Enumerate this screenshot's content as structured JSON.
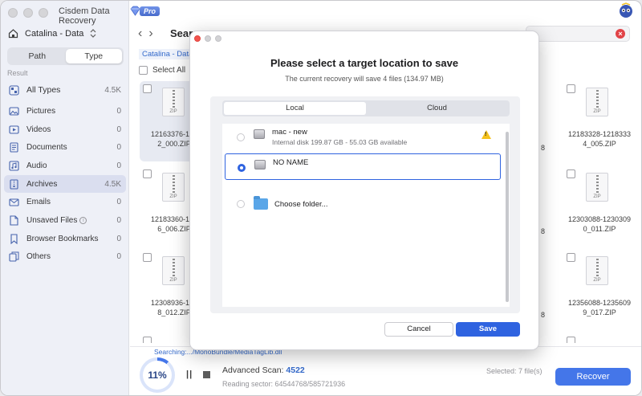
{
  "app": {
    "title": "Cisdem Data Recovery",
    "badge": "Pro"
  },
  "sidebar": {
    "drive_name": "Catalina - Data",
    "view_tabs": [
      "Path",
      "Type"
    ],
    "active_view": "Type",
    "result_label": "Result",
    "items": [
      {
        "label": "All Types",
        "count": "4.5K",
        "icon": "all-types-icon"
      },
      {
        "label": "Pictures",
        "count": "0",
        "icon": "picture-icon"
      },
      {
        "label": "Videos",
        "count": "0",
        "icon": "video-icon"
      },
      {
        "label": "Documents",
        "count": "0",
        "icon": "document-icon"
      },
      {
        "label": "Audio",
        "count": "0",
        "icon": "audio-icon"
      },
      {
        "label": "Archives",
        "count": "4.5K",
        "icon": "archive-icon"
      },
      {
        "label": "Emails",
        "count": "0",
        "icon": "email-icon"
      },
      {
        "label": "Unsaved Files",
        "count": "0",
        "icon": "unsaved-files-icon"
      },
      {
        "label": "Browser Bookmarks",
        "count": "0",
        "icon": "bookmark-icon"
      },
      {
        "label": "Others",
        "count": "0",
        "icon": "others-icon"
      }
    ],
    "active_item": "Archives"
  },
  "main": {
    "title_fragment": "Sear",
    "breadcrumb": "Catalina - Data",
    "select_all_label": "Select All",
    "files": {
      "col1": [
        "12163376-121\n2_000.ZIP",
        "12183360-121\n6_006.ZIP",
        "12308936-123\n8_012.ZIP"
      ],
      "col_right": [
        "12183328-1218333\n4_005.ZIP",
        "12303088-1230309\n0_011.ZIP",
        "12356088-1235609\n9_017.ZIP"
      ],
      "right_edge_fragments": [
        "8",
        "8",
        "8"
      ],
      "zip_label": "ZIP"
    },
    "status_searching": "Searching:.../MonoBundle/MediaTagLib.dll"
  },
  "bottom": {
    "progress_percent": "11%",
    "progress_value": 0.11,
    "scan_label": "Advanced Scan:",
    "scan_count": "4522",
    "reading_sector": "Reading sector: 64544768/585721936",
    "selected": "Selected: 7 file(s)",
    "recover_label": "Recover"
  },
  "dialog": {
    "title": "Please select a target location to save",
    "subtitle": "The current recovery will save 4 files (134.97 MB)",
    "tabs": [
      "Local",
      "Cloud"
    ],
    "active_tab": "Local",
    "locations": [
      {
        "name": "mac - new",
        "detail": "Internal disk 199.87 GB - 55.03 GB available",
        "warning": true
      },
      {
        "name": "NO NAME",
        "detail": "",
        "selected": true
      },
      {
        "name": "Choose folder...",
        "detail": ""
      }
    ],
    "cancel_label": "Cancel",
    "save_label": "Save"
  },
  "colors": {
    "accent": "#2f63e0",
    "sidebar_bg": "#eef0f7",
    "active_item_bg": "#d8ddef",
    "warning": "#f5c21b",
    "close_red": "#f3544f"
  }
}
